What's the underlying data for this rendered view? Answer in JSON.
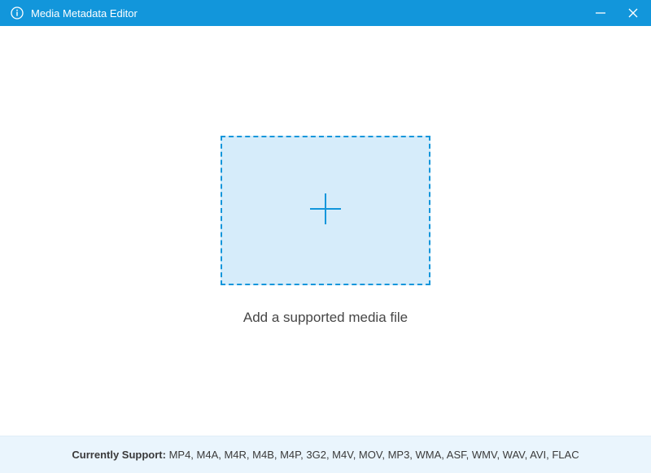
{
  "titlebar": {
    "title": "Media Metadata Editor",
    "icons": {
      "app": "info-icon",
      "minimize": "minimize-icon",
      "close": "close-icon"
    }
  },
  "main": {
    "dropzone_icon": "plus-icon",
    "dropzone_label": "Add a supported media file"
  },
  "footer": {
    "label": "Currently Support: ",
    "formats": "MP4, M4A, M4R, M4B, M4P, 3G2, M4V, MOV, MP3, WMA, ASF, WMV, WAV, AVI, FLAC"
  },
  "colors": {
    "accent": "#1296db",
    "dropzone_bg": "#d6ecfa",
    "footer_bg": "#eaf5fd"
  }
}
